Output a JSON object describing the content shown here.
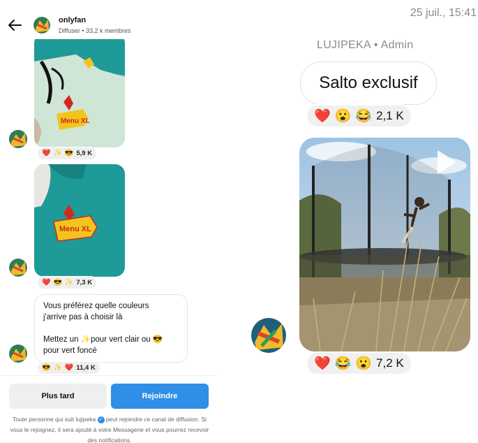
{
  "channel": {
    "name": "onlyfan",
    "subtitle": "Diffuser • 33,2 k membres"
  },
  "messages": {
    "reaction1": {
      "emojis": [
        "❤️",
        "✨",
        "😎"
      ],
      "count": "5,9 K"
    },
    "reaction2": {
      "emojis": [
        "❤️",
        "😎",
        "✨"
      ],
      "count": "7,3 K"
    },
    "text": {
      "line1": "Vous préférez quelle couleurs",
      "line2": "j'arrive pas à choisir là",
      "line3": "Mettez un ✨pour vert clair ou 😎",
      "line4": "pour vert foncé"
    },
    "reaction3": {
      "emojis": [
        "😎",
        "✨",
        "❤️"
      ],
      "count": "11,4 K"
    }
  },
  "footer": {
    "later_label": "Plus tard",
    "join_label": "Rejoindre",
    "note_part1": "Toute personne qui suit lujipeka",
    "note_part2": " peut rejoindre ce canal de diffusion. Si vous le rejoignez, il sera ajouté à votre Messagerie et vous pourrez recevoir des notifications."
  },
  "right": {
    "timestamp": "25 juil., 15:41",
    "sender": "LUJIPEKA",
    "sender_role": " • Admin",
    "message": "Salto exclusif",
    "reaction1": {
      "emojis": [
        "❤️",
        "😮",
        "😂"
      ],
      "count": "2,1 K"
    },
    "reaction2": {
      "emojis": [
        "❤️",
        "😂",
        "😮"
      ],
      "count": "7,2 K"
    }
  },
  "icons": {
    "back": "arrow-left-icon",
    "play": "play-icon",
    "verified": "verified-badge-icon"
  },
  "colors": {
    "accent": "#2f8ee6",
    "shirt_teal": "#1e9a98",
    "shirt_mint": "#cfe6d6"
  }
}
